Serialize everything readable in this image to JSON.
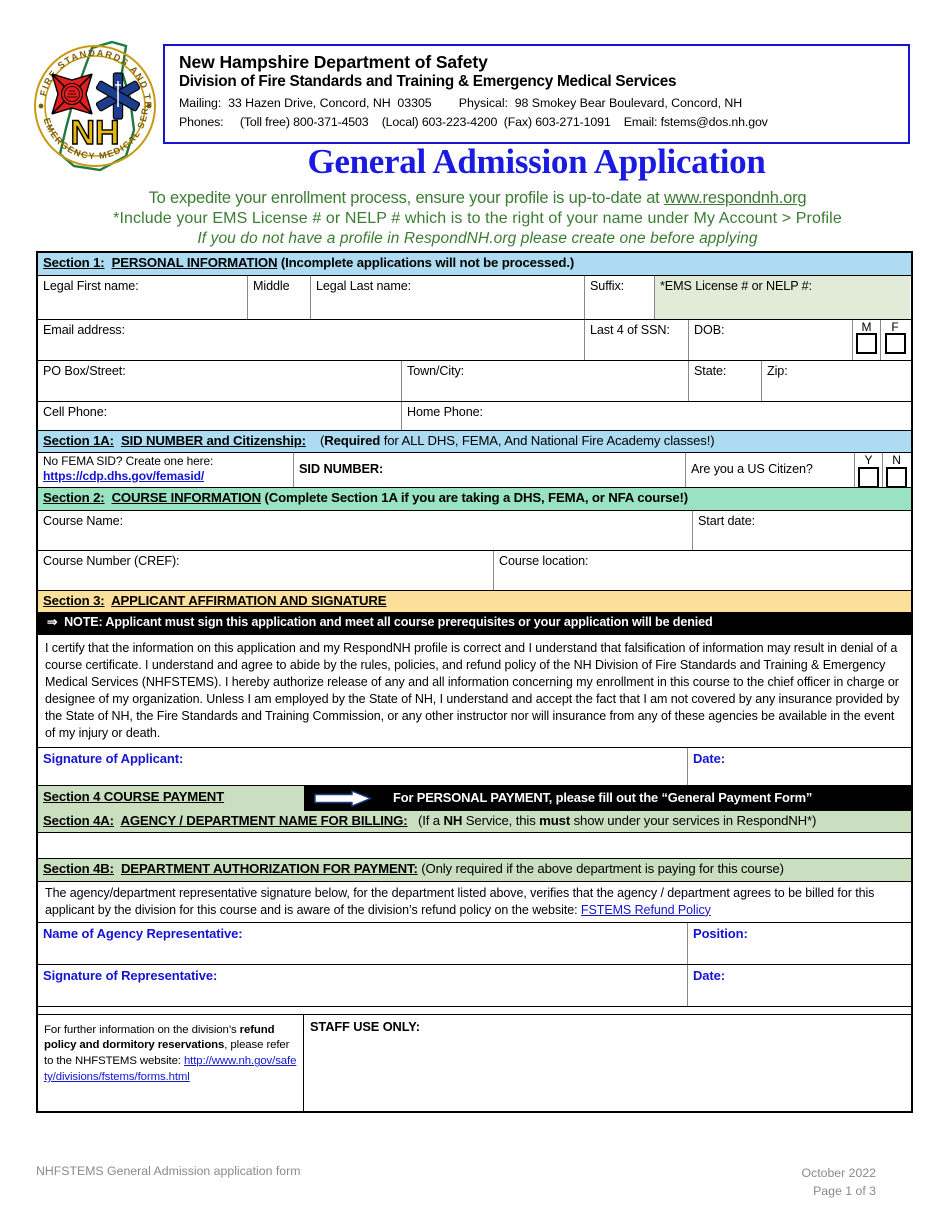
{
  "header": {
    "logo_alt": "NH Fire Standards and Training & Emergency Medical Services seal",
    "org_name": "New Hampshire Department of Safety",
    "org_division": "Division of Fire Standards and Training & Emergency Medical Services",
    "mailing_label": "Mailing:",
    "mailing_value": "33 Hazen Drive, Concord, NH  03305",
    "physical_label": "Physical:",
    "physical_value": "98 Smokey Bear Boulevard, Concord, NH",
    "phones_label": "Phones:",
    "phones_value": "(Toll free) 800-371-4503    (Local) 603-223-4200  (Fax) 603-271-1091",
    "email_label": "Email:",
    "email_value": "fstems@dos.nh.gov",
    "title": "General Admission Application",
    "subtitle_1_pre": "To expedite your enrollment process, ensure your profile is up-to-date at ",
    "subtitle_1_link": "www.respondnh.org",
    "subtitle_2": "*Include your EMS License # or NELP # which is to the right of your name under My Account > Profile",
    "subtitle_3": "If you do not have a profile in RespondNH.org please create one before applying"
  },
  "section1": {
    "label": "Section 1:",
    "title": "PERSONAL INFORMATION",
    "note": "(Incomplete applications will not be processed.)",
    "fields": {
      "first_name": "Legal First name:",
      "middle": "Middle",
      "last_name": "Legal Last name:",
      "suffix": "Suffix:",
      "ems_license": "*EMS License # or NELP #:",
      "email": "Email address:",
      "ssn_last4": "Last 4 of SSN:",
      "dob": "DOB:",
      "sex_m": "M",
      "sex_f": "F",
      "po_box": "PO Box/Street:",
      "town_city": "Town/City:",
      "state": "State:",
      "zip": "Zip:",
      "cell_phone": "Cell Phone:",
      "home_phone": "Home Phone:"
    }
  },
  "section1a": {
    "label": "Section 1A:",
    "title": "SID NUMBER and Citizenship:",
    "note_bold": "Required",
    "note_rest": " for ALL DHS, FEMA, And National Fire Academy classes!)",
    "note_open": "(",
    "no_sid_text": "No FEMA SID? Create one here:",
    "sid_link": "https://cdp.dhs.gov/femasid/",
    "sid_number": "SID NUMBER:",
    "citizen_question": "Are you a US Citizen?",
    "citizen_y": "Y",
    "citizen_n": "N"
  },
  "section2": {
    "label": "Section 2:",
    "title": "COURSE INFORMATION",
    "note": "(Complete Section 1A if you are taking a DHS, FEMA, or NFA course!)",
    "fields": {
      "course_name": "Course Name:",
      "start_date": "Start date:",
      "course_number": "Course Number (CREF):",
      "course_location": "Course location:"
    }
  },
  "section3": {
    "label": "Section 3:",
    "title": "APPLICANT AFFIRMATION AND SIGNATURE",
    "note_arrow": "⇒",
    "note": "NOTE:  Applicant must sign this application and meet all course prerequisites or your application will be denied",
    "affirmation": "I certify that the information on this application and my RespondNH profile is correct and I understand that falsification of information may result in denial of a course certificate. I understand and agree to abide by the rules, policies, and refund policy of the NH Division of Fire Standards and Training & Emergency Medical Services (NHFSTEMS).  I hereby authorize release of any and all information concerning my enrollment in this course to the chief officer in charge or designee of my organization.  Unless I am employed by the State of NH, I understand and accept the fact that I am not covered by any insurance provided by the State of NH, the Fire Standards and Training Commission, or any other instructor nor will insurance from any of these agencies be available in the event of my injury or death.",
    "signature_label": "Signature of Applicant:",
    "date_label": "Date:"
  },
  "section4": {
    "label": "Section 4 COURSE PAYMENT",
    "arrow_icon": "right-arrow-icon",
    "personal_payment_note": "For PERSONAL PAYMENT, please fill out the “General Payment Form”"
  },
  "section4a": {
    "label": "Section 4A:",
    "title": "AGENCY / DEPARTMENT NAME FOR BILLING:",
    "note_1": "(If a ",
    "note_nh": "NH",
    "note_2": " Service, this ",
    "note_must": "must",
    "note_3": " show under your services in RespondNH*)"
  },
  "section4b": {
    "label": "Section 4B:",
    "title": "DEPARTMENT AUTHORIZATION FOR PAYMENT:",
    "note": "(Only required if the above department is paying for this course)",
    "paragraph_pre": "The agency/department representative signature below, for the department listed above, verifies that the agency / department agrees to be billed for this applicant by the division for this course and is aware of the division’s refund policy on the website: ",
    "paragraph_link": "FSTEMS Refund Policy",
    "name_label": "Name of Agency Representative:",
    "position_label": "Position:",
    "signature_label": "Signature of Representative:",
    "date_label": "Date:"
  },
  "footer_boxes": {
    "refund_pre": "For further information on the division’s ",
    "refund_bold": "refund policy and dormitory reservations",
    "refund_post": ", please refer to the NHFSTEMS website: ",
    "refund_link": "http://www.nh.gov/safety/divisions/fstems/forms.html",
    "staff_use": "STAFF USE ONLY:"
  },
  "footer": {
    "left": "NHFSTEMS General Admission application form",
    "date": "October 2022",
    "page": "Page 1 of 3"
  },
  "colors": {
    "section1_band": "#ADDCF2",
    "section2_band": "#9AE3C2",
    "section3_band": "#FBDF9B",
    "section4_band": "#C9DFC0",
    "ems_cell": "#E2EBD8",
    "title_blue": "#1A1AE0",
    "subtitle_green": "#3B7C33",
    "link_blue": "#1414D2",
    "footer_gray": "#8A8A8A"
  }
}
